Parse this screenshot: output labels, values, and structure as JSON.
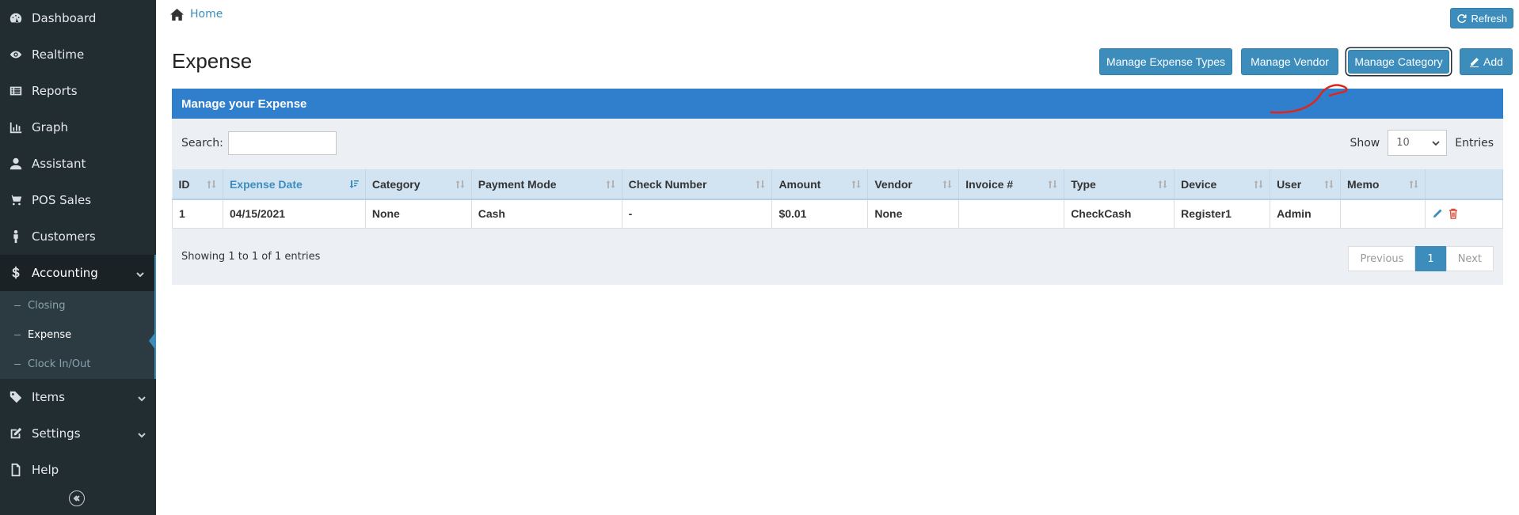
{
  "sidebar": {
    "items": [
      {
        "label": "Dashboard",
        "icon": "dashboard-icon"
      },
      {
        "label": "Realtime",
        "icon": "eye-icon"
      },
      {
        "label": "Reports",
        "icon": "reports-icon"
      },
      {
        "label": "Graph",
        "icon": "bar-chart-icon"
      },
      {
        "label": "Assistant",
        "icon": "user-icon"
      },
      {
        "label": "POS Sales",
        "icon": "cart-icon"
      },
      {
        "label": "Customers",
        "icon": "person-icon"
      },
      {
        "label": "Accounting",
        "icon": "dollar-icon"
      },
      {
        "label": "Items",
        "icon": "tag-icon"
      },
      {
        "label": "Settings",
        "icon": "edit-icon"
      },
      {
        "label": "Help",
        "icon": "file-icon"
      }
    ],
    "accounting_sub": [
      {
        "label": "Closing"
      },
      {
        "label": "Expense"
      },
      {
        "label": "Clock In/Out"
      }
    ]
  },
  "breadcrumb": {
    "home": "Home"
  },
  "header": {
    "refresh": "Refresh",
    "title": "Expense",
    "buttons": {
      "types": "Manage Expense Types",
      "vendor": "Manage Vendor",
      "category": "Manage Category",
      "add": "Add"
    }
  },
  "box": {
    "title": "Manage your Expense",
    "search_label": "Search:",
    "search_value": "",
    "show_label": "Show",
    "entries_value": "10",
    "entries_label": "Entries",
    "columns": [
      "ID",
      "Expense Date",
      "Category",
      "Payment Mode",
      "Check Number",
      "Amount",
      "Vendor",
      "Invoice #",
      "Type",
      "Device",
      "User",
      "Memo",
      ""
    ],
    "rows": [
      [
        "1",
        "04/15/2021",
        "None",
        "Cash",
        "-",
        "$0.01",
        "None",
        "",
        "CheckCash",
        "Register1",
        "Admin",
        ""
      ]
    ],
    "info": "Showing 1 to 1 of 1 entries",
    "pager": {
      "previous": "Previous",
      "current": "1",
      "next": "Next"
    }
  },
  "colors": {
    "accent": "#3c8dbc",
    "sidebar": "#222d32",
    "box_header": "#307fcd",
    "annotation": "#e0261a"
  }
}
